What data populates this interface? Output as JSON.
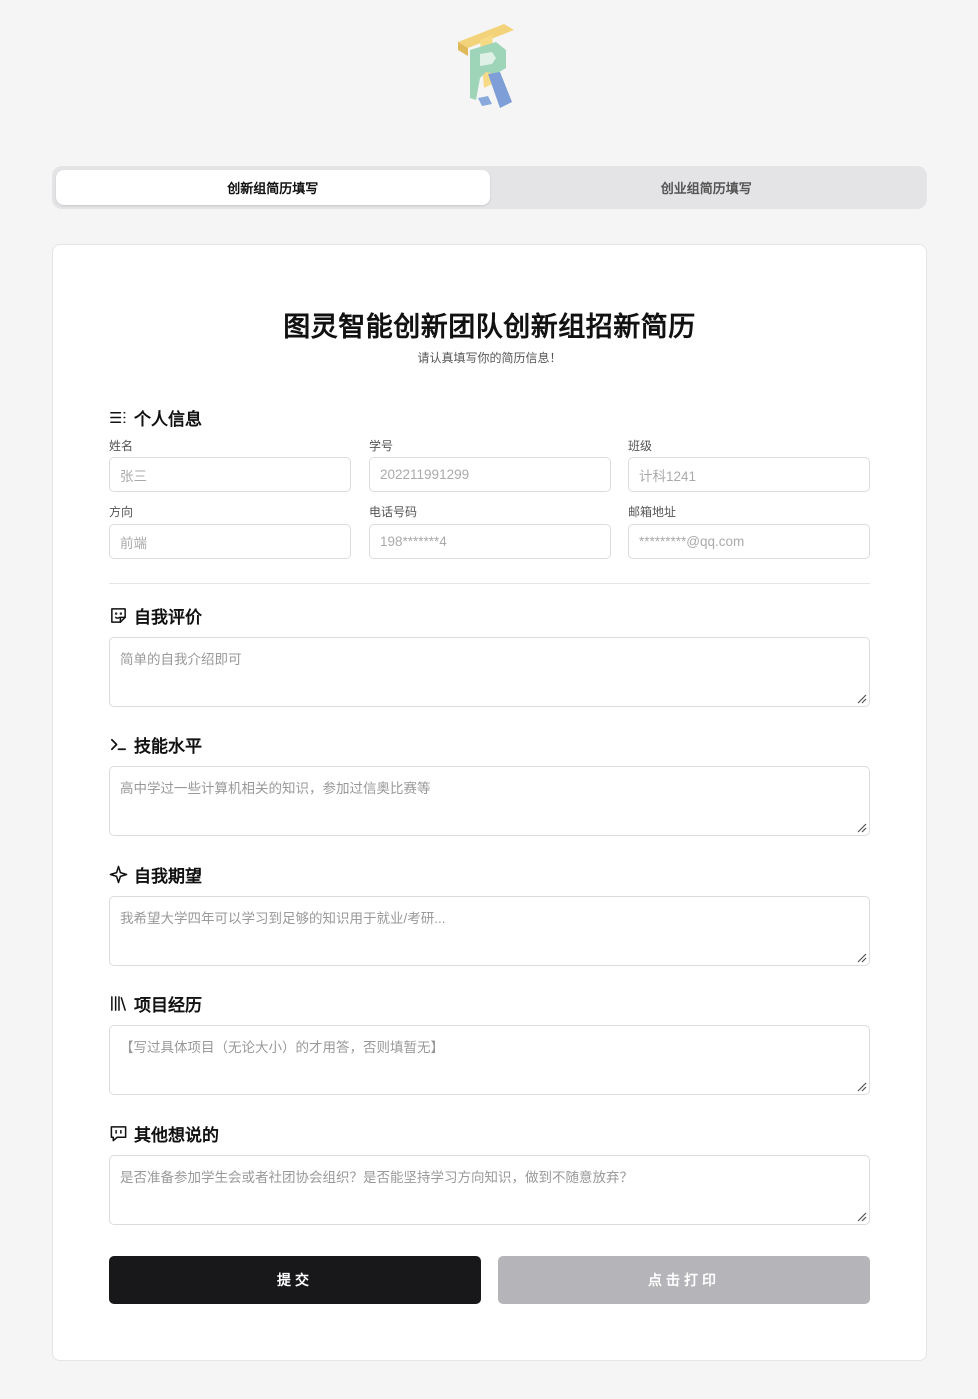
{
  "tabs": [
    {
      "label": "创新组简历填写",
      "active": true
    },
    {
      "label": "创业组简历填写",
      "active": false
    }
  ],
  "form": {
    "title": "图灵智能创新团队创新组招新简历",
    "subtitle": "请认真填写你的简历信息！",
    "personal": {
      "heading": "个人信息",
      "fields": [
        {
          "label": "姓名",
          "placeholder": "张三"
        },
        {
          "label": "学号",
          "placeholder": "202211991299"
        },
        {
          "label": "班级",
          "placeholder": "计科1241"
        },
        {
          "label": "方向",
          "placeholder": "前端"
        },
        {
          "label": "电话号码",
          "placeholder": "198*******4"
        },
        {
          "label": "邮箱地址",
          "placeholder": "*********@qq.com"
        }
      ]
    },
    "sections": [
      {
        "heading": "自我评价",
        "icon": "smile-square-icon",
        "placeholder": "简单的自我介绍即可"
      },
      {
        "heading": "技能水平",
        "icon": "terminal-icon",
        "placeholder": "高中学过一些计算机相关的知识，参加过信奥比赛等"
      },
      {
        "heading": "自我期望",
        "icon": "sparkle-icon",
        "placeholder": "我希望大学四年可以学习到足够的知识用于就业/考研..."
      },
      {
        "heading": "项目经历",
        "icon": "library-icon",
        "placeholder": "【写过具体项目（无论大小）的才用答，否则填暂无】"
      },
      {
        "heading": "其他想说的",
        "icon": "message-icon",
        "placeholder": "是否准备参加学生会或者社团协会组织？是否能坚持学习方向知识，做到不随意放弃？"
      }
    ],
    "submit_label": "提交",
    "print_label": "点击打印"
  },
  "colors": {
    "primary_button": "#18181b",
    "disabled_button": "#b5b5b9",
    "page_background": "#f5f5f5"
  }
}
